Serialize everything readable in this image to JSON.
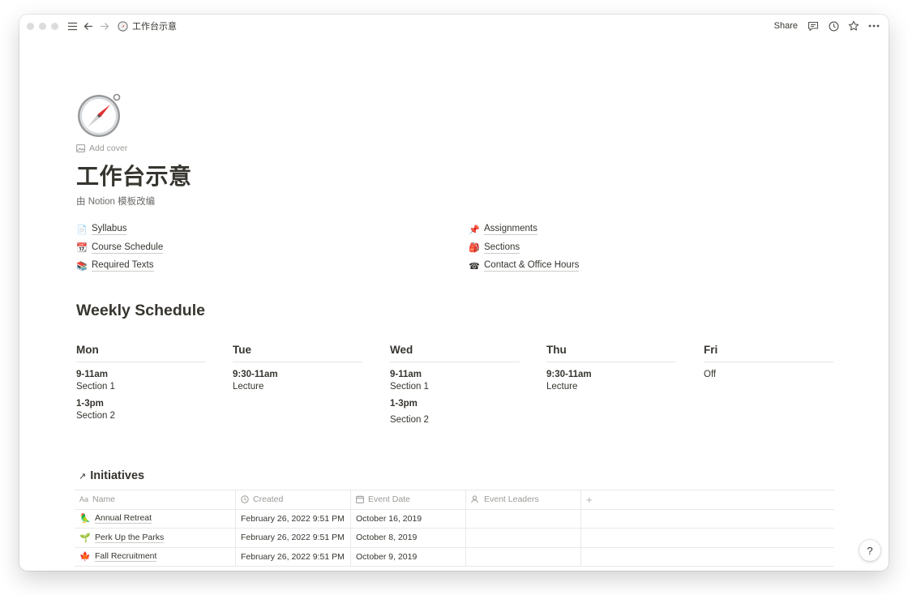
{
  "topbar": {
    "breadcrumb_title": "工作台示意",
    "share_label": "Share",
    "icons": [
      "menu-icon",
      "back-arrow-icon",
      "forward-arrow-icon",
      "compass-icon",
      "comment-icon",
      "clock-icon",
      "star-icon",
      "more-icon"
    ]
  },
  "page": {
    "add_cover_label": "Add cover",
    "title": "工作台示意",
    "subtitle": "由 Notion 模板改编"
  },
  "links": {
    "left": [
      {
        "icon": "document-icon",
        "label": "Syllabus"
      },
      {
        "icon": "calendar-icon",
        "label": "Course Schedule"
      },
      {
        "icon": "books-icon",
        "label": "Required Texts"
      }
    ],
    "right": [
      {
        "icon": "pushpin-icon",
        "label": "Assignments"
      },
      {
        "icon": "backpack-icon",
        "label": "Sections"
      },
      {
        "icon": "telephone-icon",
        "label": "Contact & Office Hours"
      }
    ]
  },
  "weekly": {
    "heading": "Weekly Schedule",
    "days": [
      {
        "name": "Mon",
        "slots": [
          {
            "time": "9-11am",
            "desc": "Section 1"
          },
          {
            "time": "1-3pm",
            "desc": "Section 2"
          }
        ]
      },
      {
        "name": "Tue",
        "slots": [
          {
            "time": "9:30-11am",
            "desc": "Lecture"
          }
        ]
      },
      {
        "name": "Wed",
        "slots": [
          {
            "time": "9-11am",
            "desc": "Section 1"
          },
          {
            "time": "1-3pm",
            "desc": "Section 2"
          }
        ]
      },
      {
        "name": "Thu",
        "slots": [
          {
            "time": "9:30-11am",
            "desc": "Lecture"
          }
        ]
      },
      {
        "name": "Fri",
        "note": "Off"
      }
    ]
  },
  "initiatives": {
    "heading": "Initiatives",
    "columns": [
      {
        "icon": "text-icon",
        "label": "Name"
      },
      {
        "icon": "clock-icon",
        "label": "Created"
      },
      {
        "icon": "calendar-icon",
        "label": "Event Date"
      },
      {
        "icon": "person-icon",
        "label": "Event Leaders"
      }
    ],
    "add_column_label": "+",
    "rows": [
      {
        "icon": "parrot-icon",
        "name": "Annual Retreat",
        "created": "February 26, 2022 9:51 PM",
        "event_date": "October 16, 2019",
        "leaders": ""
      },
      {
        "icon": "seedling-icon",
        "name": "Perk Up the Parks",
        "created": "February 26, 2022 9:51 PM",
        "event_date": "October 8, 2019",
        "leaders": ""
      },
      {
        "icon": "maple-leaf-icon",
        "name": "Fall Recruitment",
        "created": "February 26, 2022 9:51 PM",
        "event_date": "October 9, 2019",
        "leaders": ""
      }
    ]
  },
  "help_label": "?"
}
